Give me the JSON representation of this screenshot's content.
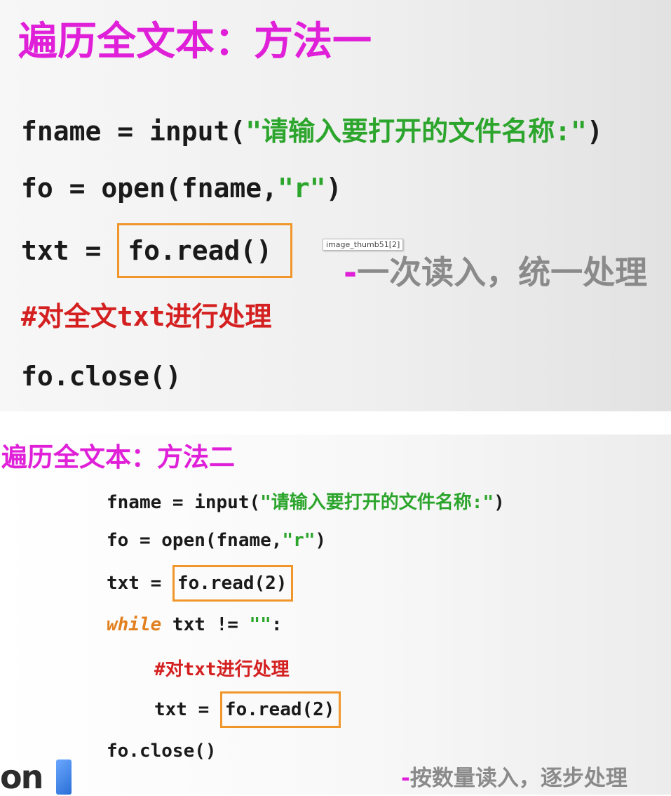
{
  "slide1": {
    "title": "遍历全文本：方法一",
    "code": {
      "line1": {
        "pre": "fname = input(",
        "str": "\"请输入要打开的文件名称:\"",
        "post": ")"
      },
      "line2": {
        "pre": "fo = open(fname,",
        "str": "\"r\"",
        "post": ")"
      },
      "line3": {
        "pre": "txt = ",
        "boxed": "fo.read()"
      },
      "line4": "#对全文txt进行处理",
      "line5": "fo.close()"
    },
    "note_dash": "-",
    "note": "一次读入，统一处理",
    "tooltip": "image_thumb51[2]"
  },
  "slide2": {
    "title": "遍历全文本：方法二",
    "code": {
      "line1": {
        "pre": "fname = input(",
        "str": "\"请输入要打开的文件名称:\"",
        "post": ")"
      },
      "line2": {
        "pre": "fo = open(fname,",
        "str": "\"r\"",
        "post": ")"
      },
      "line3": {
        "pre": "txt = ",
        "boxed": "fo.read(2)"
      },
      "line4": {
        "kw": "while",
        "rest": " txt != ",
        "str": "\"\"",
        "post": ":"
      },
      "line5": "#对txt进行处理",
      "line6": {
        "pre": "txt = ",
        "boxed": "fo.read(2)"
      },
      "line7": "fo.close()"
    },
    "note_dash": "-",
    "note": "按数量读入，逐步处理"
  },
  "logo_text": "on"
}
